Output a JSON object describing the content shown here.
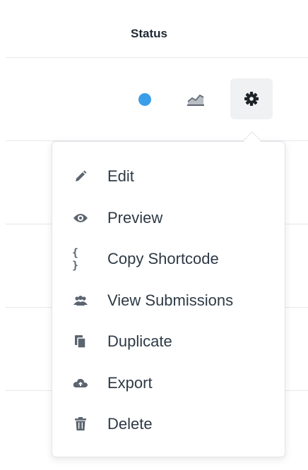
{
  "table": {
    "column_header": "Status"
  },
  "row": {
    "status_color": "#3b9ee8",
    "icons": [
      "status-dot",
      "chart-icon",
      "gear-icon"
    ]
  },
  "menu": {
    "items": [
      {
        "label": "Edit",
        "icon": "pencil-icon"
      },
      {
        "label": "Preview",
        "icon": "eye-icon"
      },
      {
        "label": "Copy Shortcode",
        "icon": "braces-icon",
        "glyph": "{ }"
      },
      {
        "label": "View Submissions",
        "icon": "users-icon"
      },
      {
        "label": "Duplicate",
        "icon": "copy-icon"
      },
      {
        "label": "Export",
        "icon": "cloud-upload-icon"
      },
      {
        "label": "Delete",
        "icon": "trash-icon"
      }
    ]
  }
}
